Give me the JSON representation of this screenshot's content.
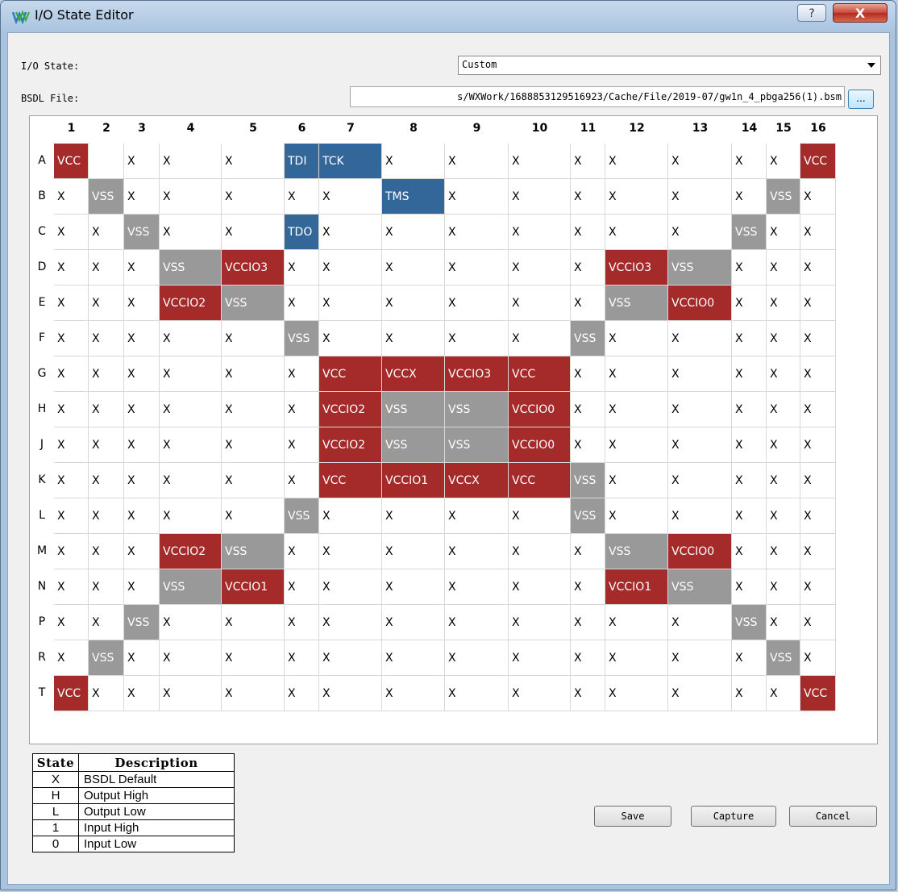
{
  "window": {
    "title": "I/O State Editor",
    "help_glyph": "?",
    "close_glyph": "X"
  },
  "io_state": {
    "label": "I/O State:",
    "value": "Custom"
  },
  "bsdl": {
    "label": "BSDL File:",
    "value": "s/WXWork/1688853129516923/Cache/File/2019-07/gw1n_4_pbga256(1).bsm",
    "browse_label": "..."
  },
  "grid": {
    "columns": [
      "1",
      "2",
      "3",
      "4",
      "5",
      "6",
      "7",
      "8",
      "9",
      "10",
      "11",
      "12",
      "13",
      "14",
      "15",
      "16"
    ],
    "rows": [
      {
        "label": "A",
        "cells": [
          "VCC",
          "",
          "X",
          "X",
          "X",
          "TDI",
          "TCK",
          "X",
          "X",
          "X",
          "X",
          "X",
          "X",
          "X",
          "X",
          "VCC"
        ]
      },
      {
        "label": "B",
        "cells": [
          "X",
          "VSS",
          "X",
          "X",
          "X",
          "X",
          "X",
          "TMS",
          "X",
          "X",
          "X",
          "X",
          "X",
          "X",
          "VSS",
          "X"
        ]
      },
      {
        "label": "C",
        "cells": [
          "X",
          "X",
          "VSS",
          "X",
          "X",
          "TDO",
          "X",
          "X",
          "X",
          "X",
          "X",
          "X",
          "X",
          "VSS",
          "X",
          "X"
        ]
      },
      {
        "label": "D",
        "cells": [
          "X",
          "X",
          "X",
          "VSS",
          "VCCIO3",
          "X",
          "X",
          "X",
          "X",
          "X",
          "X",
          "VCCIO3",
          "VSS",
          "X",
          "X",
          "X"
        ]
      },
      {
        "label": "E",
        "cells": [
          "X",
          "X",
          "X",
          "VCCIO2",
          "VSS",
          "X",
          "X",
          "X",
          "X",
          "X",
          "X",
          "VSS",
          "VCCIO0",
          "X",
          "X",
          "X"
        ]
      },
      {
        "label": "F",
        "cells": [
          "X",
          "X",
          "X",
          "X",
          "X",
          "VSS",
          "X",
          "X",
          "X",
          "X",
          "VSS",
          "X",
          "X",
          "X",
          "X",
          "X"
        ]
      },
      {
        "label": "G",
        "cells": [
          "X",
          "X",
          "X",
          "X",
          "X",
          "X",
          "VCC",
          "VCCX",
          "VCCIO3",
          "VCC",
          "X",
          "X",
          "X",
          "X",
          "X",
          "X"
        ]
      },
      {
        "label": "H",
        "cells": [
          "X",
          "X",
          "X",
          "X",
          "X",
          "X",
          "VCCIO2",
          "VSS",
          "VSS",
          "VCCIO0",
          "X",
          "X",
          "X",
          "X",
          "X",
          "X"
        ]
      },
      {
        "label": "J",
        "cells": [
          "X",
          "X",
          "X",
          "X",
          "X",
          "X",
          "VCCIO2",
          "VSS",
          "VSS",
          "VCCIO0",
          "X",
          "X",
          "X",
          "X",
          "X",
          "X"
        ]
      },
      {
        "label": "K",
        "cells": [
          "X",
          "X",
          "X",
          "X",
          "X",
          "X",
          "VCC",
          "VCCIO1",
          "VCCX",
          "VCC",
          "VSS",
          "X",
          "X",
          "X",
          "X",
          "X"
        ]
      },
      {
        "label": "L",
        "cells": [
          "X",
          "X",
          "X",
          "X",
          "X",
          "VSS",
          "X",
          "X",
          "X",
          "X",
          "VSS",
          "X",
          "X",
          "X",
          "X",
          "X"
        ]
      },
      {
        "label": "M",
        "cells": [
          "X",
          "X",
          "X",
          "VCCIO2",
          "VSS",
          "X",
          "X",
          "X",
          "X",
          "X",
          "X",
          "VSS",
          "VCCIO0",
          "X",
          "X",
          "X"
        ]
      },
      {
        "label": "N",
        "cells": [
          "X",
          "X",
          "X",
          "VSS",
          "VCCIO1",
          "X",
          "X",
          "X",
          "X",
          "X",
          "X",
          "VCCIO1",
          "VSS",
          "X",
          "X",
          "X"
        ]
      },
      {
        "label": "P",
        "cells": [
          "X",
          "X",
          "VSS",
          "X",
          "X",
          "X",
          "X",
          "X",
          "X",
          "X",
          "X",
          "X",
          "X",
          "VSS",
          "X",
          "X"
        ]
      },
      {
        "label": "R",
        "cells": [
          "X",
          "VSS",
          "X",
          "X",
          "X",
          "X",
          "X",
          "X",
          "X",
          "X",
          "X",
          "X",
          "X",
          "X",
          "VSS",
          "X"
        ]
      },
      {
        "label": "T",
        "cells": [
          "VCC",
          "X",
          "X",
          "X",
          "X",
          "X",
          "X",
          "X",
          "X",
          "X",
          "X",
          "X",
          "X",
          "X",
          "X",
          "VCC"
        ]
      }
    ],
    "colors": {
      "power": "#a52a2a",
      "ground": "#999999",
      "jtag": "#336699"
    }
  },
  "legend": {
    "header_state": "State",
    "header_desc": "Description",
    "rows": [
      {
        "state": "X",
        "desc": "BSDL Default"
      },
      {
        "state": "H",
        "desc": "Output High"
      },
      {
        "state": "L",
        "desc": "Output Low"
      },
      {
        "state": "1",
        "desc": "Input High"
      },
      {
        "state": "0",
        "desc": "Input Low"
      }
    ]
  },
  "buttons": {
    "save": "Save",
    "capture": "Capture",
    "cancel": "Cancel"
  }
}
